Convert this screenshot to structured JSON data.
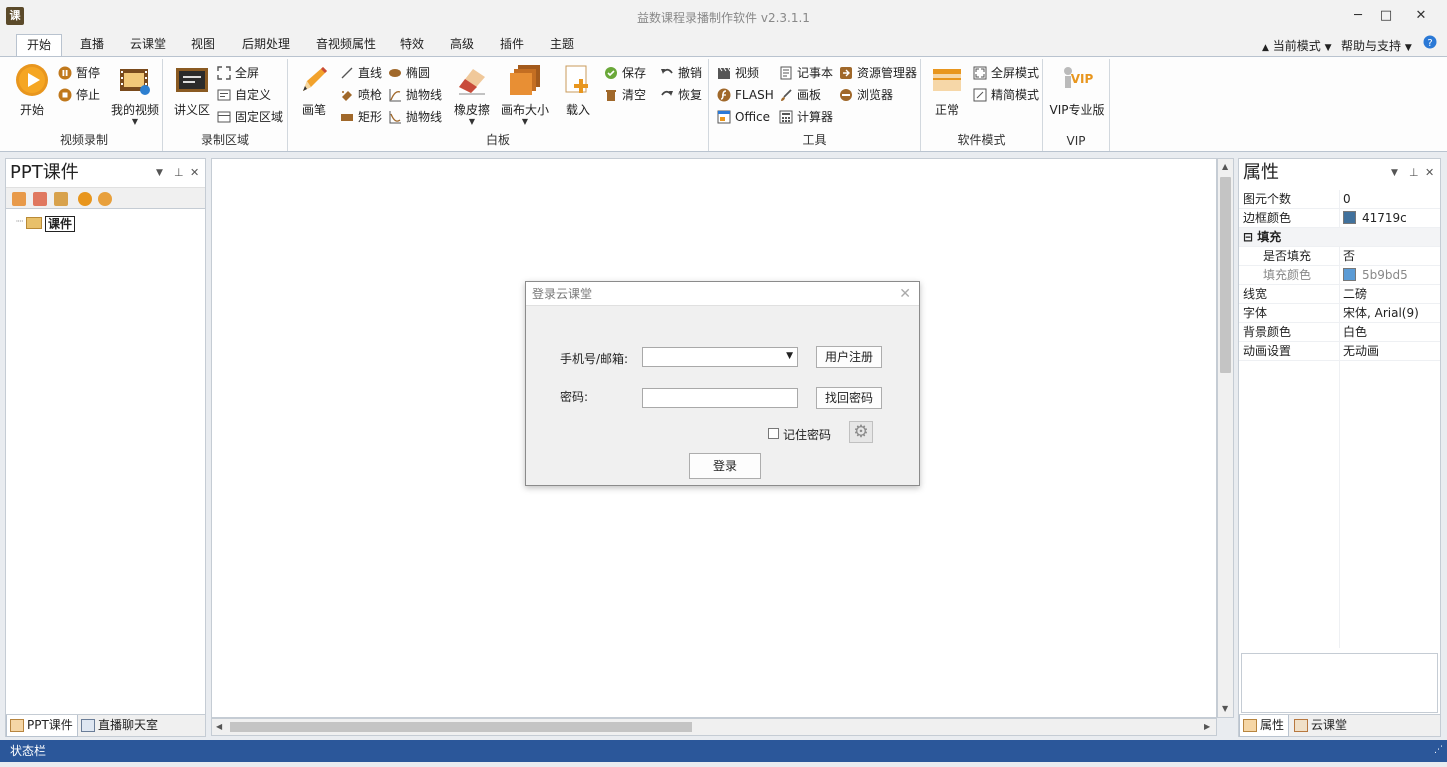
{
  "window": {
    "title": "益数课程录播制作软件 v2.3.1.1",
    "icon_text": "课",
    "minimize": "─",
    "maximize": "□",
    "close": "✕"
  },
  "tabs": [
    "开始",
    "直播",
    "云课堂",
    "视图",
    "后期处理",
    "音视频属性",
    "特效",
    "高级",
    "插件",
    "主题"
  ],
  "right_menu": {
    "mode": "当前模式",
    "help": "帮助与支持"
  },
  "ribbon": {
    "video_record": {
      "label": "视频录制",
      "start": "开始",
      "pause": "暂停",
      "stop": "停止",
      "my_video": "我的视频"
    },
    "record_area": {
      "label": "录制区域",
      "lecture": "讲义区",
      "fullscreen": "全屏",
      "custom": "自定义",
      "fixed": "固定区域"
    },
    "whiteboard": {
      "label": "白板",
      "pen": "画笔",
      "line": "直线",
      "ellipse": "椭圆",
      "spray": "喷枪",
      "parabola1": "抛物线",
      "rect": "矩形",
      "parabola2": "抛物线",
      "eraser": "橡皮擦",
      "canvas_size": "画布大小",
      "load": "载入",
      "save": "保存",
      "clear": "清空",
      "undo": "撤销",
      "redo": "恢复"
    },
    "tools": {
      "label": "工具",
      "video": "视频",
      "flash": "FLASH",
      "office": "Office",
      "notepad": "记事本",
      "draw": "画板",
      "calc": "计算器",
      "explorer": "资源管理器",
      "browser": "浏览器"
    },
    "soft_mode": {
      "label": "软件模式",
      "normal": "正常",
      "full_mode": "全屏模式",
      "simple_mode": "精简模式"
    },
    "vip": {
      "label": "VIP",
      "pro": "VIP专业版"
    }
  },
  "left_panel": {
    "title": "PPT课件",
    "tree_root": "课件",
    "tabs": [
      "PPT课件",
      "直播聊天室"
    ]
  },
  "right_panel": {
    "title": "属性",
    "props": [
      {
        "name": "图元个数",
        "value": "0"
      },
      {
        "name": "边框颜色",
        "value": "41719c",
        "color": "#41719c"
      },
      {
        "name": "填充",
        "value": "",
        "section": true,
        "toggle": "⊟"
      },
      {
        "name": "是否填充",
        "value": "否",
        "sub": true
      },
      {
        "name": "填充颜色",
        "value": "5b9bd5",
        "color": "#5b9bd5",
        "sub": true,
        "dim": true
      },
      {
        "name": "线宽",
        "value": "二磅"
      },
      {
        "name": "字体",
        "value": "宋体, Arial(9)"
      },
      {
        "name": "背景颜色",
        "value": "白色"
      },
      {
        "name": "动画设置",
        "value": "无动画"
      }
    ],
    "tabs": [
      "属性",
      "云课堂"
    ]
  },
  "statusbar": {
    "text": "状态栏"
  },
  "login_dialog": {
    "title": "登录云课堂",
    "phone_label": "手机号/邮箱:",
    "phone_value": "",
    "register": "用户注册",
    "password_label": "密码:",
    "password_value": "",
    "forgot": "找回密码",
    "remember": "记住密码",
    "login": "登录"
  },
  "colors": {
    "accent": "#2b579a",
    "border_color": "#41719c",
    "fill_color": "#5b9bd5"
  }
}
